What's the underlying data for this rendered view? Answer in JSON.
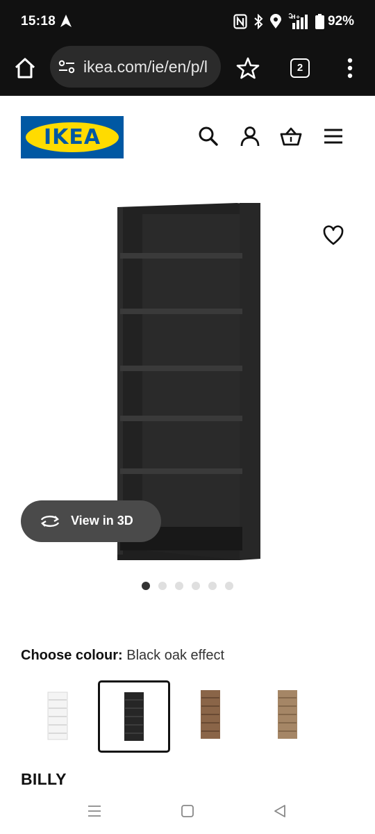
{
  "status_bar": {
    "time": "15:18",
    "battery": "92%",
    "icons": [
      "navigation-arrow-icon",
      "nfc-icon",
      "bluetooth-icon",
      "location-icon",
      "signal-icon",
      "battery-icon"
    ]
  },
  "browser": {
    "url": "ikea.com/ie/en/p/l",
    "tab_count": "2",
    "icons": [
      "home-icon",
      "site-settings-icon",
      "bookmark-star-icon",
      "tabs-icon",
      "more-menu-icon"
    ]
  },
  "header": {
    "logo_text": "IKEA",
    "icons": [
      "search-icon",
      "account-icon",
      "basket-icon",
      "menu-icon"
    ]
  },
  "gallery": {
    "view_3d_label": "View in 3D",
    "image_count": 6,
    "active_index": 0
  },
  "colour": {
    "label": "Choose colour:",
    "value": "Black oak effect",
    "options": [
      {
        "name": "white",
        "color": "#f2f2f2",
        "selected": false
      },
      {
        "name": "black-oak-effect",
        "color": "#2a2a2a",
        "selected": true
      },
      {
        "name": "brown-walnut-effect",
        "color": "#8a6548",
        "selected": false
      },
      {
        "name": "oak-effect",
        "color": "#a58666",
        "selected": false
      }
    ]
  },
  "product": {
    "name": "BILLY"
  },
  "colors": {
    "ikea_blue": "#0058a3",
    "ikea_yellow": "#ffdb00",
    "browser_chrome": "#111111"
  }
}
